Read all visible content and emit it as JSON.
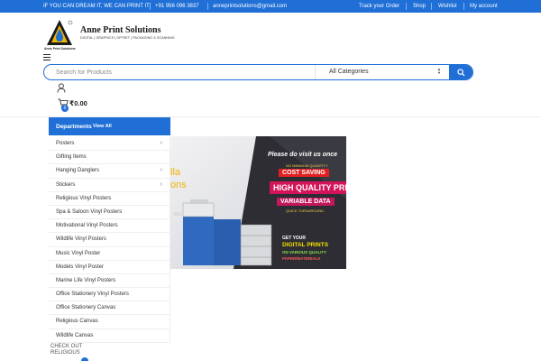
{
  "topbar": {
    "tagline": "IF YOU CAN DREAM IT, WE CAN PRINT IT",
    "phone": "+91 956 096 3837",
    "email": "anneprintsolutions@gmail.com",
    "links": [
      "Track your Order",
      "Shop",
      "Wishlist",
      "My account"
    ]
  },
  "brand": {
    "name": "Anne Print Solutions",
    "tagline": "DIGITAL | GRAPHICS | OFFSET | PACKAGING & SCANNING",
    "logo_caption": "Anne Print Solutions"
  },
  "search": {
    "placeholder": "Search for Products",
    "category": "All Categories"
  },
  "cart": {
    "count": "0",
    "total": "₹0.00"
  },
  "departments": {
    "title": "Departments",
    "view_all": "View All",
    "items": [
      {
        "label": "Posters",
        "has_submenu": true
      },
      {
        "label": "Gifting Items",
        "has_submenu": false
      },
      {
        "label": "Hanging Danglers",
        "has_submenu": true
      },
      {
        "label": "Stickers",
        "has_submenu": true
      },
      {
        "label": "Religious Vinyl Posters",
        "has_submenu": false
      },
      {
        "label": "Spa & Saloon Vinyl Posters",
        "has_submenu": false
      },
      {
        "label": "Motivational Vinyl Posters",
        "has_submenu": false
      },
      {
        "label": "Wildlife Vinyl Posters",
        "has_submenu": false
      },
      {
        "label": "Music Vinyl Poster",
        "has_submenu": false
      },
      {
        "label": "Models Vinyl Poster",
        "has_submenu": false
      },
      {
        "label": "Marine Life Vinyl Posters",
        "has_submenu": false
      },
      {
        "label": "Office Stationery Vinyl Posters",
        "has_submenu": false
      },
      {
        "label": "Office Stationery Canvas",
        "has_submenu": false
      },
      {
        "label": "Religious Canvas",
        "has_submenu": false
      },
      {
        "label": "Wildlife Canvas",
        "has_submenu": false
      }
    ]
  },
  "banner": {
    "partial_left": "lla",
    "partial_left2": "ons",
    "headline": "Please do visit us once",
    "lines": [
      "NO MINIMUM QUANTITY",
      "COST SAVING",
      "HIGH QUALITY PRINTS",
      "VARIABLE DATA",
      "QUICK TURNAROUND"
    ],
    "bottom": [
      "GET YOUR",
      "DIGITAL PRINTS",
      "ON VARIOUS QUALITY",
      "PAPER/MATERIALS"
    ]
  },
  "peek_text": [
    "CHECK OUT",
    "RELIGIOUS"
  ],
  "colors": {
    "accent": "#1f6fd6"
  }
}
